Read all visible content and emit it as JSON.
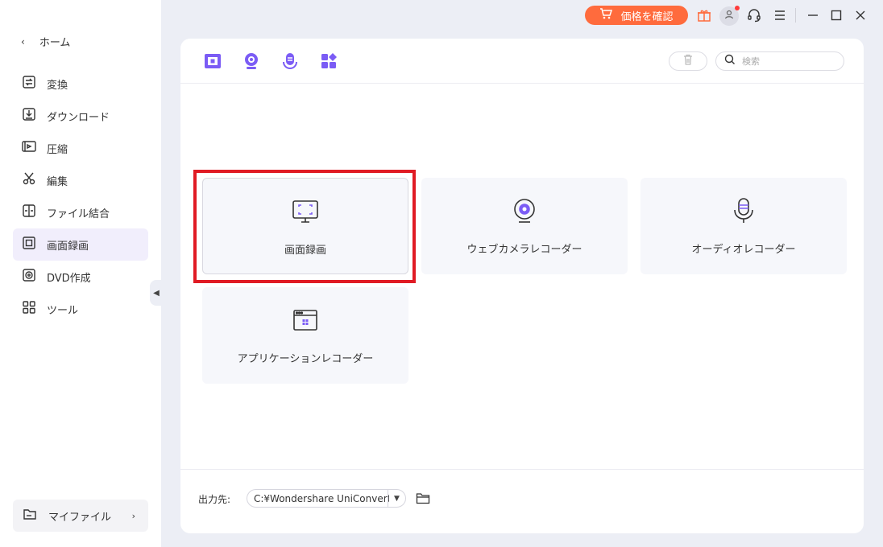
{
  "sidebar": {
    "home_label": "ホーム",
    "items": [
      {
        "label": "変換",
        "icon": "convert-icon"
      },
      {
        "label": "ダウンロード",
        "icon": "download-icon"
      },
      {
        "label": "圧縮",
        "icon": "compress-icon"
      },
      {
        "label": "編集",
        "icon": "edit-icon"
      },
      {
        "label": "ファイル結合",
        "icon": "merge-icon"
      },
      {
        "label": "画面録画",
        "icon": "screen-record-icon",
        "active": true
      },
      {
        "label": "DVD作成",
        "icon": "dvd-icon"
      },
      {
        "label": "ツール",
        "icon": "tools-icon"
      }
    ],
    "myfiles_label": "マイファイル"
  },
  "topbar": {
    "price_label": "価格を確認"
  },
  "header": {
    "search_placeholder": "検索"
  },
  "tiles": [
    {
      "label": "画面録画",
      "icon": "monitor-icon"
    },
    {
      "label": "ウェブカメラレコーダー",
      "icon": "webcam-icon"
    },
    {
      "label": "オーディオレコーダー",
      "icon": "microphone-icon"
    },
    {
      "label": "アプリケーションレコーダー",
      "icon": "app-window-icon"
    }
  ],
  "footer": {
    "output_label": "出力先:",
    "output_path": "C:¥Wondershare UniConverter"
  },
  "colors": {
    "accent": "#7b5cf5",
    "price_button": "#ff6b3d",
    "highlight": "#e01b24"
  }
}
